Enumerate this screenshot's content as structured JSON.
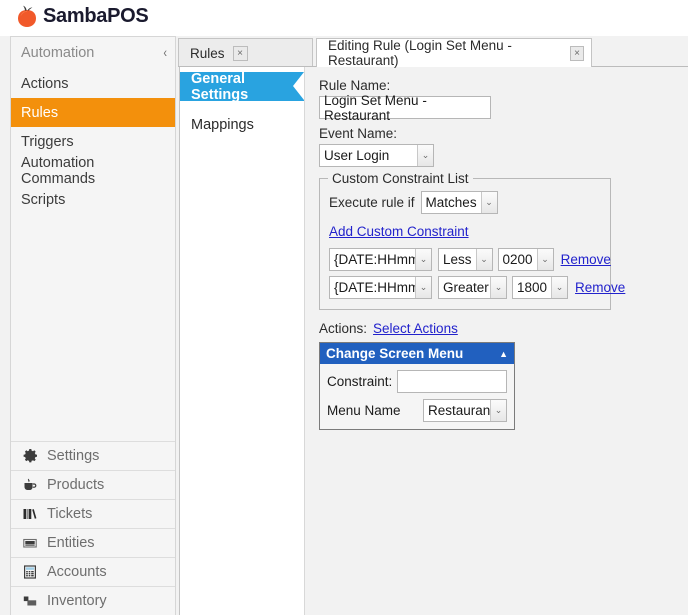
{
  "app": {
    "title": "SambaPOS",
    "logo_color": "#f1592a"
  },
  "sidebar": {
    "header": {
      "label": "Automation",
      "collapse_icon": "chevron-left-icon",
      "chevron": "‹"
    },
    "items": [
      {
        "label": "Actions",
        "active": false
      },
      {
        "label": "Rules",
        "active": true
      },
      {
        "label": "Triggers",
        "active": false
      },
      {
        "label": "Automation Commands",
        "active": false
      },
      {
        "label": "Scripts",
        "active": false
      }
    ],
    "active_color": "#f3900c",
    "bottom_nav": [
      {
        "label": "Settings",
        "icon": "gear-icon"
      },
      {
        "label": "Products",
        "icon": "coffee-cup-icon"
      },
      {
        "label": "Tickets",
        "icon": "books-icon"
      },
      {
        "label": "Entities",
        "icon": "building-icon"
      },
      {
        "label": "Accounts",
        "icon": "calculator-icon"
      },
      {
        "label": "Inventory",
        "icon": "boxes-icon"
      }
    ]
  },
  "tabs": [
    {
      "label": "Rules",
      "active": false,
      "close_icon": "close-icon",
      "close_glyph": "×"
    },
    {
      "label": "Editing Rule (Login Set Menu - Restaurant)",
      "active": true,
      "close_icon": "close-icon",
      "close_glyph": "×"
    }
  ],
  "subpanel": {
    "items": [
      {
        "label": "General Settings",
        "active": true
      },
      {
        "label": "Mappings",
        "active": false
      }
    ],
    "active_color": "#29a3e0"
  },
  "form": {
    "rule_name_label": "Rule Name:",
    "rule_name_value": "Login Set Menu - Restaurant",
    "event_name_label": "Event Name:",
    "event_name_value": "User Login",
    "dropdown_glyph": "⌄"
  },
  "constraints": {
    "group_title": "Custom Constraint List",
    "execute_label": "Execute rule if",
    "execute_value": "Matches",
    "add_link": "Add Custom Constraint",
    "rows": [
      {
        "field": "{DATE:HHmm}",
        "operator": "Less",
        "value": "0200",
        "remove_label": "Remove"
      },
      {
        "field": "{DATE:HHmm}",
        "operator": "Greater",
        "value": "1800",
        "remove_label": "Remove"
      }
    ]
  },
  "actions": {
    "label": "Actions:",
    "select_link": "Select Actions",
    "panel": {
      "title": "Change Screen Menu",
      "header_color": "#2160bf",
      "collapse_glyph": "▲",
      "constraint_label": "Constraint:",
      "constraint_value": "",
      "menu_name_label": "Menu Name",
      "menu_name_value": "Restaurant"
    }
  }
}
